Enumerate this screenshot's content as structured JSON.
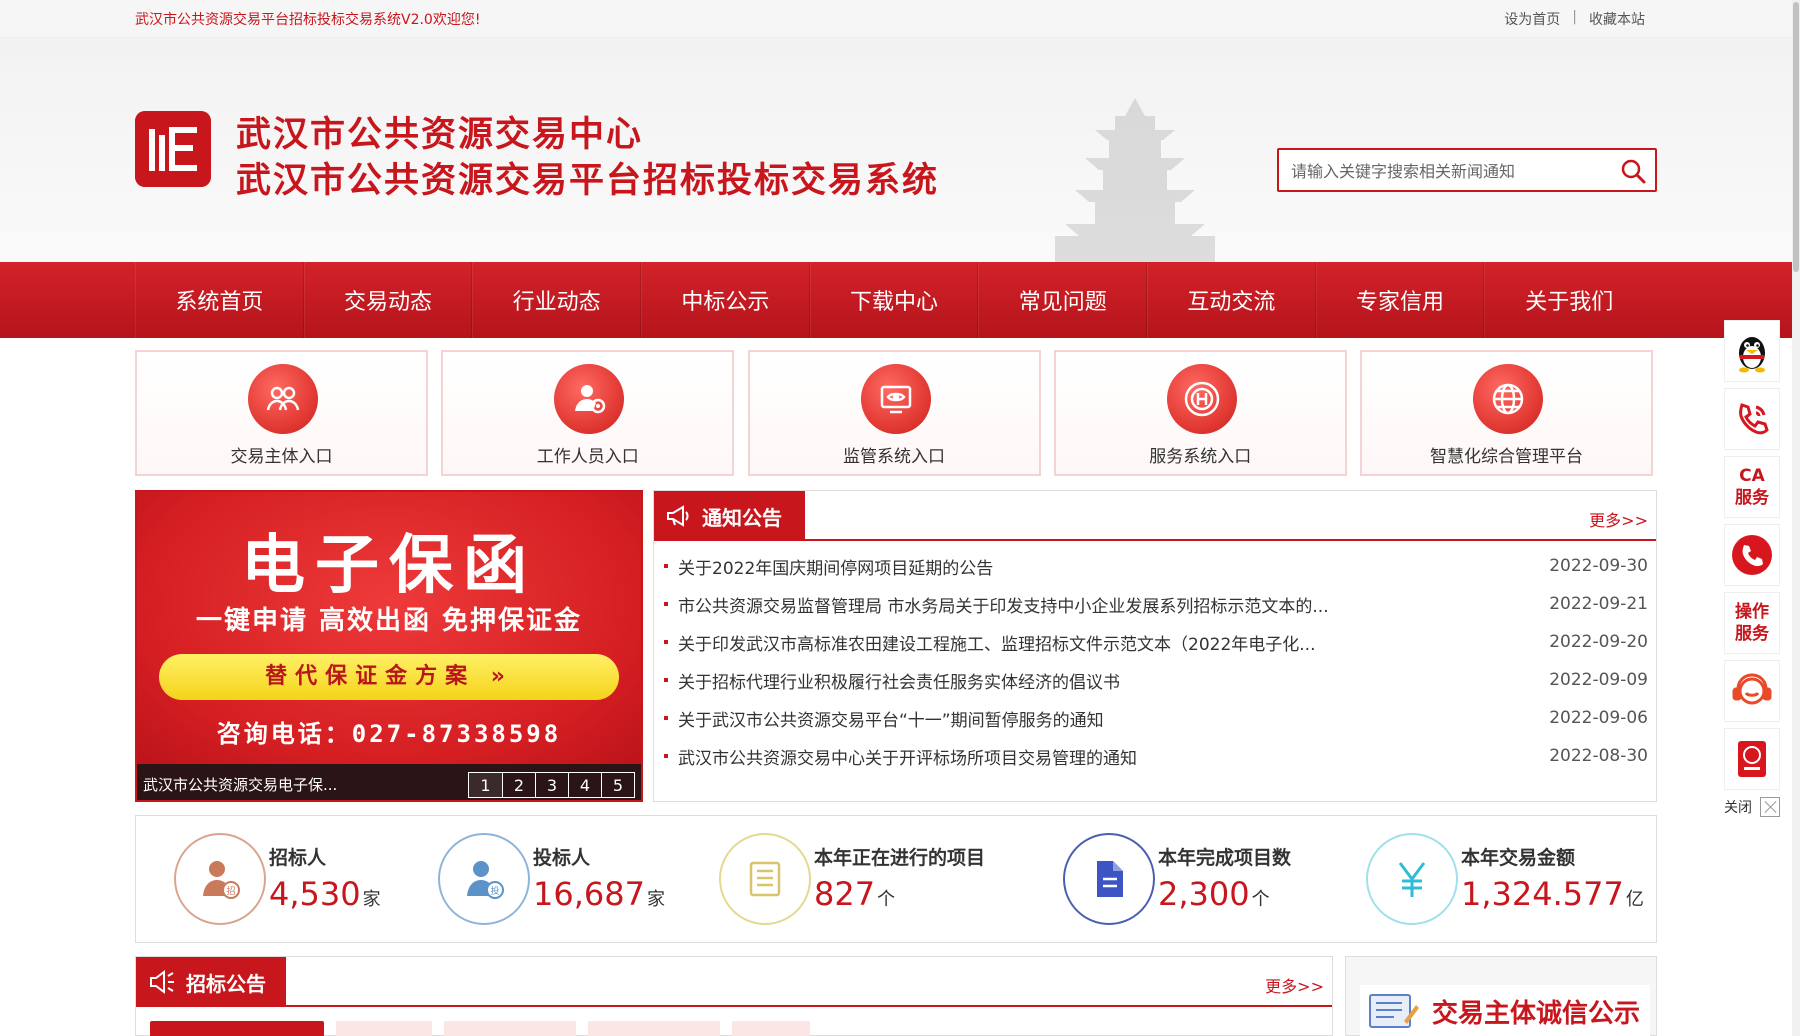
{
  "topbar": {
    "welcome": "武汉市公共资源交易平台招标投标交易系统V2.0欢迎您!",
    "set_home": "设为首页",
    "separator": "|",
    "bookmark": "收藏本站"
  },
  "header": {
    "title_line1": "武汉市公共资源交易中心",
    "title_line2": "武汉市公共资源交易平台招标投标交易系统",
    "search_placeholder": "请输入关键字搜索相关新闻通知"
  },
  "nav": {
    "items": [
      "系统首页",
      "交易动态",
      "行业动态",
      "中标公示",
      "下载中心",
      "常见问题",
      "互动交流",
      "专家信用",
      "关于我们"
    ]
  },
  "entries": [
    {
      "label": "交易主体入口",
      "icon": "users-icon"
    },
    {
      "label": "工作人员入口",
      "icon": "staff-gear-icon"
    },
    {
      "label": "监管系统入口",
      "icon": "monitor-eye-icon"
    },
    {
      "label": "服务系统入口",
      "icon": "service-h-icon"
    },
    {
      "label": "智慧化综合管理平台",
      "icon": "globe-network-icon"
    }
  ],
  "banner": {
    "title": "电子保函",
    "subtitle": "一键申请 高效出函 免押保证金",
    "pill": "替代保证金方案 »",
    "phone": "咨询电话：027-87338598",
    "caption": "武汉市公共资源交易电子保...",
    "pages": [
      "1",
      "2",
      "3",
      "4",
      "5"
    ]
  },
  "notice": {
    "title": "通知公告",
    "more": "更多>>",
    "items": [
      {
        "text": "关于2022年国庆期间停网项目延期的公告",
        "date": "2022-09-30"
      },
      {
        "text": "市公共资源交易监督管理局 市水务局关于印发支持中小企业发展系列招标示范文本的...",
        "date": "2022-09-21"
      },
      {
        "text": "关于印发武汉市高标准农田建设工程施工、监理招标文件示范文本（2022年电子化...",
        "date": "2022-09-20"
      },
      {
        "text": "关于招标代理行业积极履行社会责任服务实体经济的倡议书",
        "date": "2022-09-09"
      },
      {
        "text": "关于武汉市公共资源交易平台“十一”期间暂停服务的通知",
        "date": "2022-09-06"
      },
      {
        "text": "武汉市公共资源交易中心关于开评标场所项目交易管理的通知",
        "date": "2022-08-30"
      }
    ]
  },
  "stats": [
    {
      "label": "招标人",
      "value": "4,530",
      "unit": "家",
      "color": "#c87a5a",
      "icon": "tenderer-icon"
    },
    {
      "label": "投标人",
      "value": "16,687",
      "unit": "家",
      "color": "#5b92c8",
      "icon": "bidder-icon"
    },
    {
      "label": "本年正在进行的项目",
      "value": "827",
      "unit": "个",
      "color": "#d8c46a",
      "icon": "document-list-icon"
    },
    {
      "label": "本年完成项目数",
      "value": "2,300",
      "unit": "个",
      "color": "#4a5fb0",
      "icon": "file-icon"
    },
    {
      "label": "本年交易金额",
      "value": "1,324.577",
      "unit": "亿",
      "color": "#4ac4d8",
      "icon": "yen-icon"
    }
  ],
  "bidding": {
    "title": "招标公告",
    "more": "更多>>"
  },
  "credit": {
    "title": "交易主体诚信公示"
  },
  "float": {
    "ca_service": "CA服务",
    "op_service": "操作服务",
    "close": "关闭"
  },
  "colors": {
    "brand_red": "#c8161d",
    "nav_red": "#c41a21"
  }
}
